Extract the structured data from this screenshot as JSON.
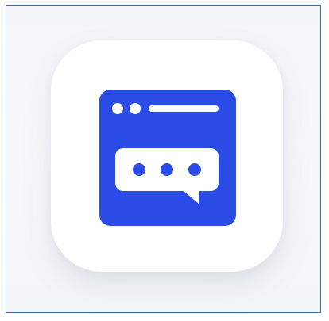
{
  "app_icon": {
    "icon_name": "browser-chat-icon",
    "accent_color": "#2a4be6",
    "glyph_color": "#ffffff",
    "tile_color": "#ffffff",
    "background_color": "#f5f6f9",
    "frame_border_color": "#3d6aa5"
  }
}
